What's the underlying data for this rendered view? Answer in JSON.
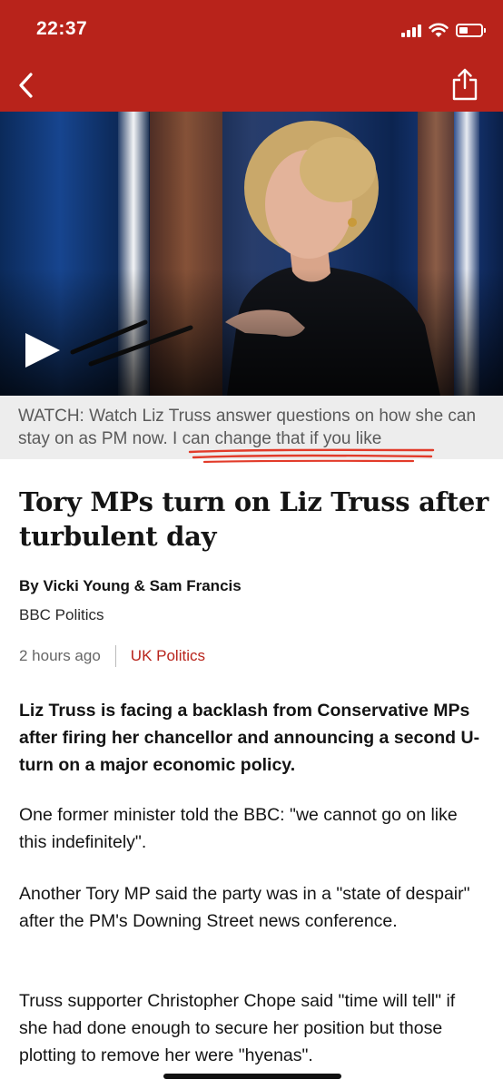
{
  "status_bar": {
    "time": "22:37"
  },
  "nav": {
    "back_icon": "chevron-left-icon",
    "share_icon": "share-icon",
    "brand_color": "#b8231b"
  },
  "video": {
    "play_icon": "play-icon"
  },
  "caption": {
    "text": "WATCH: Watch Liz Truss answer questions on how she can stay on as PM now. I can change that if you like"
  },
  "article": {
    "headline": "Tory MPs turn on Liz Truss after turbulent day",
    "byline": "By Vicki Young & Sam Francis",
    "source": "BBC Politics",
    "time": "2 hours ago",
    "topic": "UK Politics",
    "lead": "Liz Truss is facing a backlash from Conservative MPs after firing her chancellor and announcing a second U-turn on a major economic policy.",
    "paragraphs": [
      "One former minister told the BBC: \"we cannot go on like this indefinitely\".",
      "Another Tory MP said the party was in a \"state of despair\" after the PM's Downing Street news conference.",
      "Truss supporter Christopher Chope said \"time will tell\" if she had done enough to secure her position but those plotting to remove her were \"hyenas\"."
    ]
  }
}
